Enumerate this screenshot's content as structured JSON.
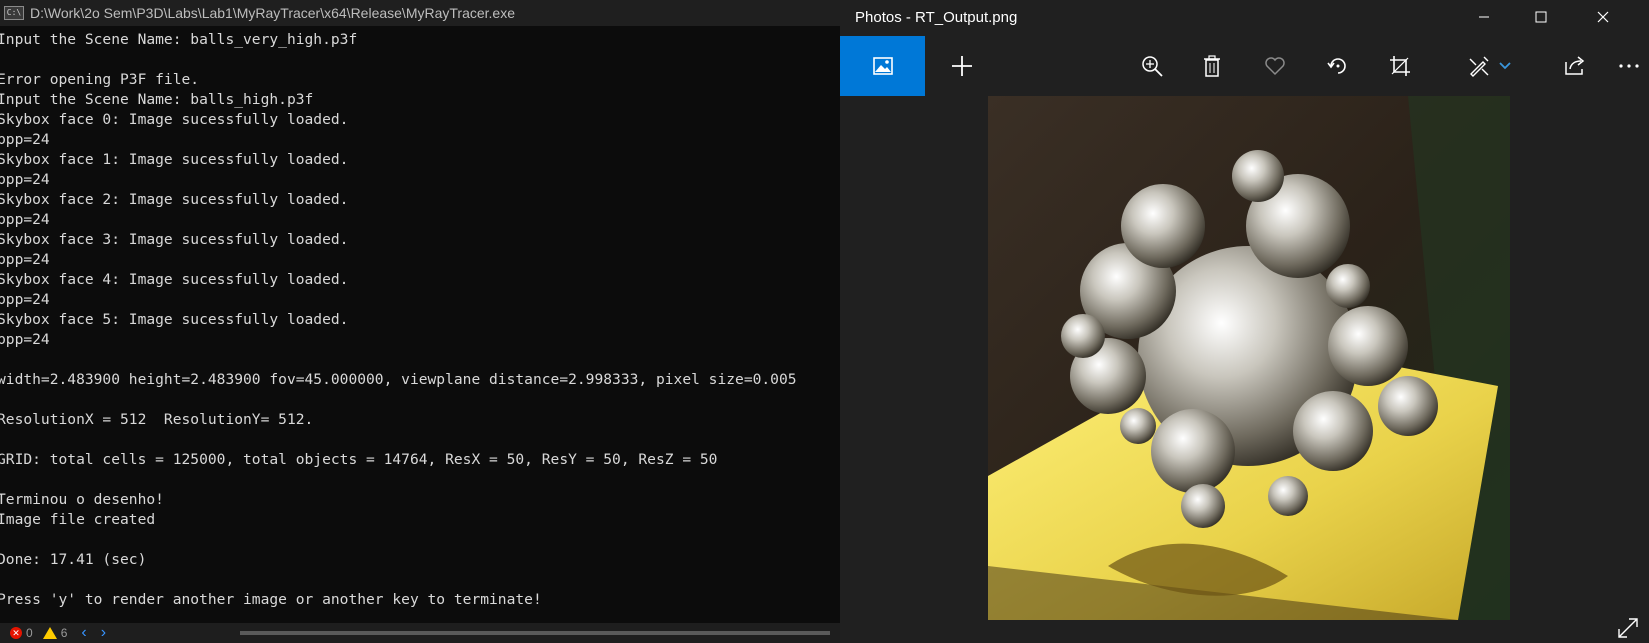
{
  "console": {
    "title": "D:\\Work\\2o Sem\\P3D\\Labs\\Lab1\\MyRayTracer\\x64\\Release\\MyRayTracer.exe",
    "icon": "console-app-icon",
    "lines": [
      "Input the Scene Name: balls_very_high.p3f",
      "",
      "Error opening P3F file.",
      "Input the Scene Name: balls_high.p3f",
      "Skybox face 0: Image sucessfully loaded.",
      "bpp=24",
      "Skybox face 1: Image sucessfully loaded.",
      "bpp=24",
      "Skybox face 2: Image sucessfully loaded.",
      "bpp=24",
      "Skybox face 3: Image sucessfully loaded.",
      "bpp=24",
      "Skybox face 4: Image sucessfully loaded.",
      "bpp=24",
      "Skybox face 5: Image sucessfully loaded.",
      "bpp=24",
      "",
      "width=2.483900 height=2.483900 fov=45.000000, viewplane distance=2.998333, pixel size=0.005",
      "",
      "ResolutionX = 512  ResolutionY= 512.",
      "",
      "GRID: total cells = 125000, total objects = 14764, ResX = 50, ResY = 50, ResZ = 50",
      "",
      "Terminou o desenho!",
      "Image file created",
      "",
      "Done: 17.41 (sec)",
      "",
      "Press 'y' to render another image or another key to terminate!"
    ],
    "statusbar": {
      "errors": "0",
      "warnings": "6"
    }
  },
  "photos": {
    "title": "Photos - RT_Output.png",
    "toolbar": {
      "items": [
        "image-icon",
        "plus-icon",
        "zoom-in-icon",
        "delete-icon",
        "heart-icon",
        "rotate-icon",
        "crop-icon",
        "edit-draw-icon",
        "share-icon",
        "more-icon"
      ]
    },
    "colors": {
      "accent": "#0078d7",
      "background": "#202020"
    }
  }
}
